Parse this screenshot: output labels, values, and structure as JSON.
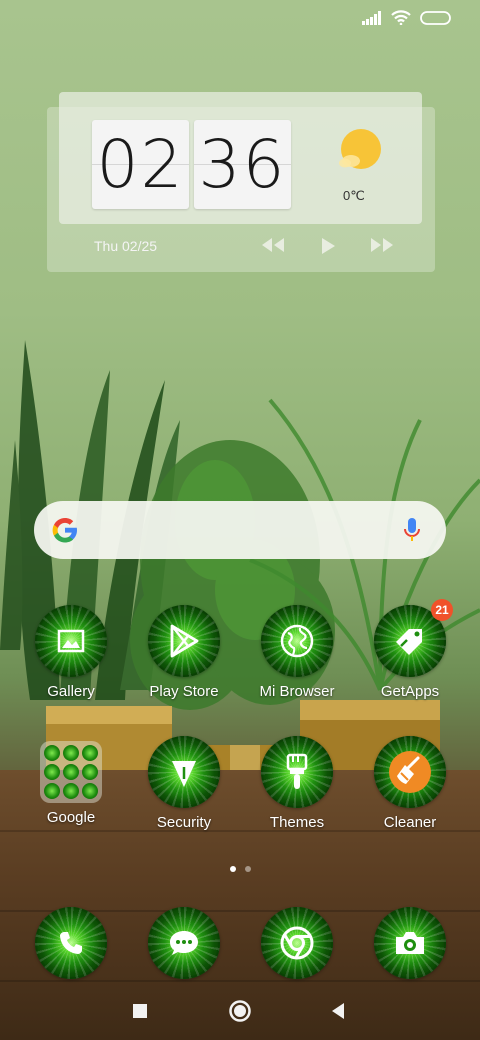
{
  "status_bar": {
    "icons": [
      "signal-icon",
      "wifi-icon",
      "battery-icon"
    ]
  },
  "clock_widget": {
    "hours": "02",
    "minutes": "36",
    "temperature": "0℃",
    "weather_icon": "partly-cloudy-icon",
    "date": "Thu 02/25",
    "media_controls": [
      "previous-icon",
      "play-icon",
      "next-icon"
    ]
  },
  "search_bar": {
    "logo": "google-g-icon",
    "mic_icon": "mic-icon"
  },
  "home_apps": [
    {
      "label": "Gallery",
      "icon": "gallery-icon"
    },
    {
      "label": "Play Store",
      "icon": "play-store-icon"
    },
    {
      "label": "Mi Browser",
      "icon": "globe-icon"
    },
    {
      "label": "GetApps",
      "icon": "tag-icon",
      "badge": "21"
    },
    {
      "label": "Google",
      "icon": "folder-icon"
    },
    {
      "label": "Security",
      "icon": "shield-icon"
    },
    {
      "label": "Themes",
      "icon": "paintbrush-icon"
    },
    {
      "label": "Cleaner",
      "icon": "broom-icon"
    }
  ],
  "page_indicator": {
    "pages": 2,
    "current": 1
  },
  "dock": [
    {
      "icon": "phone-icon"
    },
    {
      "icon": "message-icon"
    },
    {
      "icon": "chrome-icon"
    },
    {
      "icon": "camera-icon"
    }
  ],
  "navigation": [
    "recents-icon",
    "home-icon",
    "back-icon"
  ],
  "colors": {
    "icon_green": "#1f8f10",
    "badge": "#f0522a",
    "cleaner_orange": "#f08a24"
  }
}
